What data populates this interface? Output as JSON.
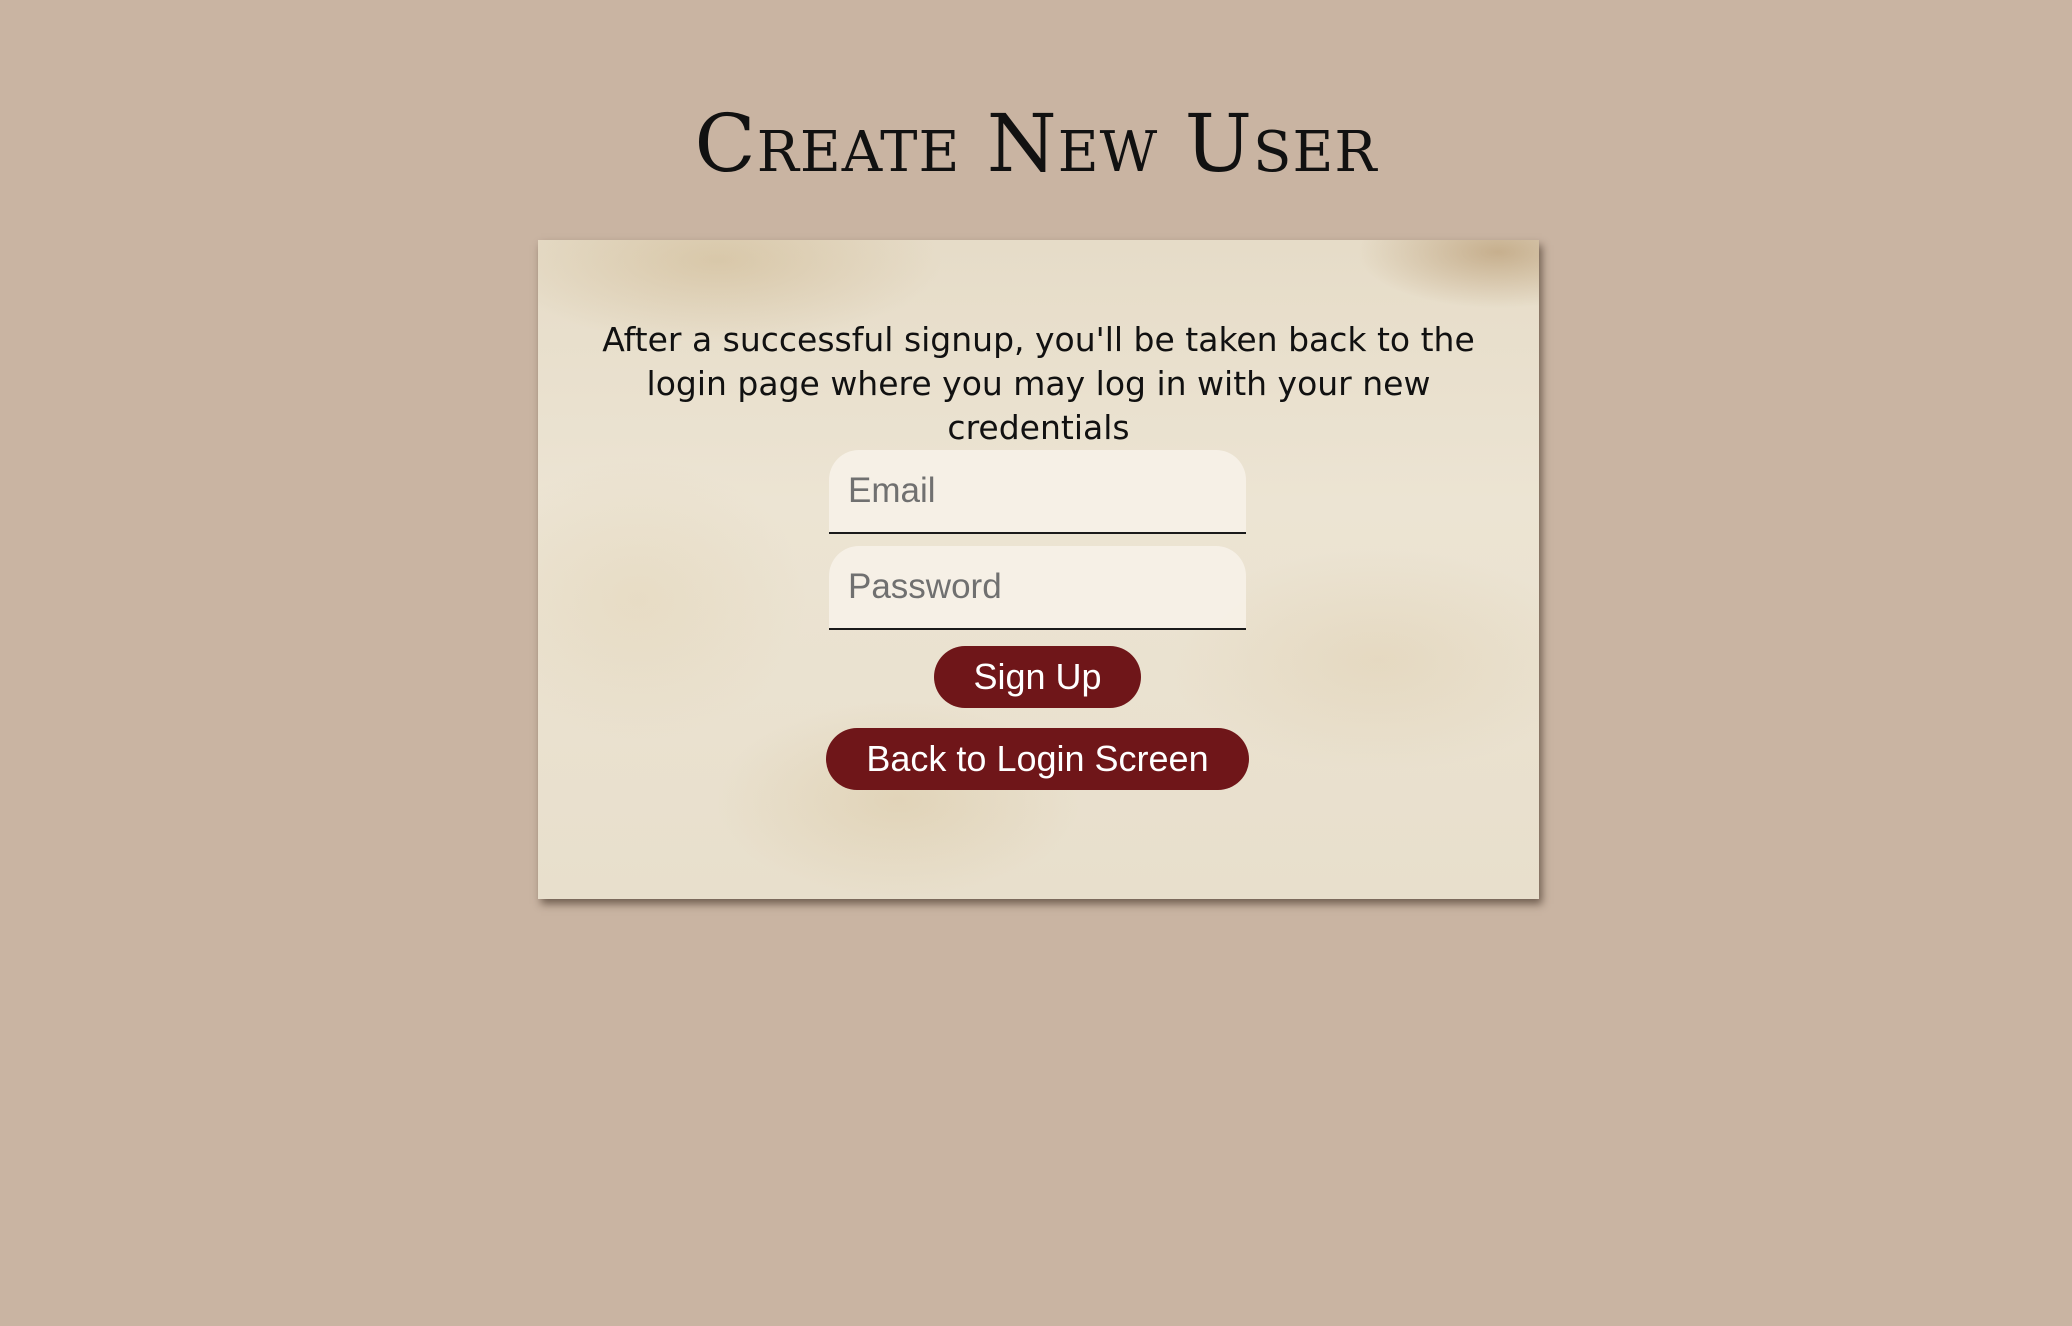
{
  "page": {
    "title": "Create New User",
    "background_color": "#c9b4a2"
  },
  "card": {
    "info_text": "After a successful signup, you'll be taken back to the login page where you may log in with your new credentials",
    "background_color": "#ebe2d0"
  },
  "form": {
    "email_placeholder": "Email",
    "email_value": "",
    "password_placeholder": "Password",
    "password_value": "",
    "signup_label": "Sign Up",
    "back_label": "Back to Login Screen",
    "button_color": "#6f1619"
  }
}
